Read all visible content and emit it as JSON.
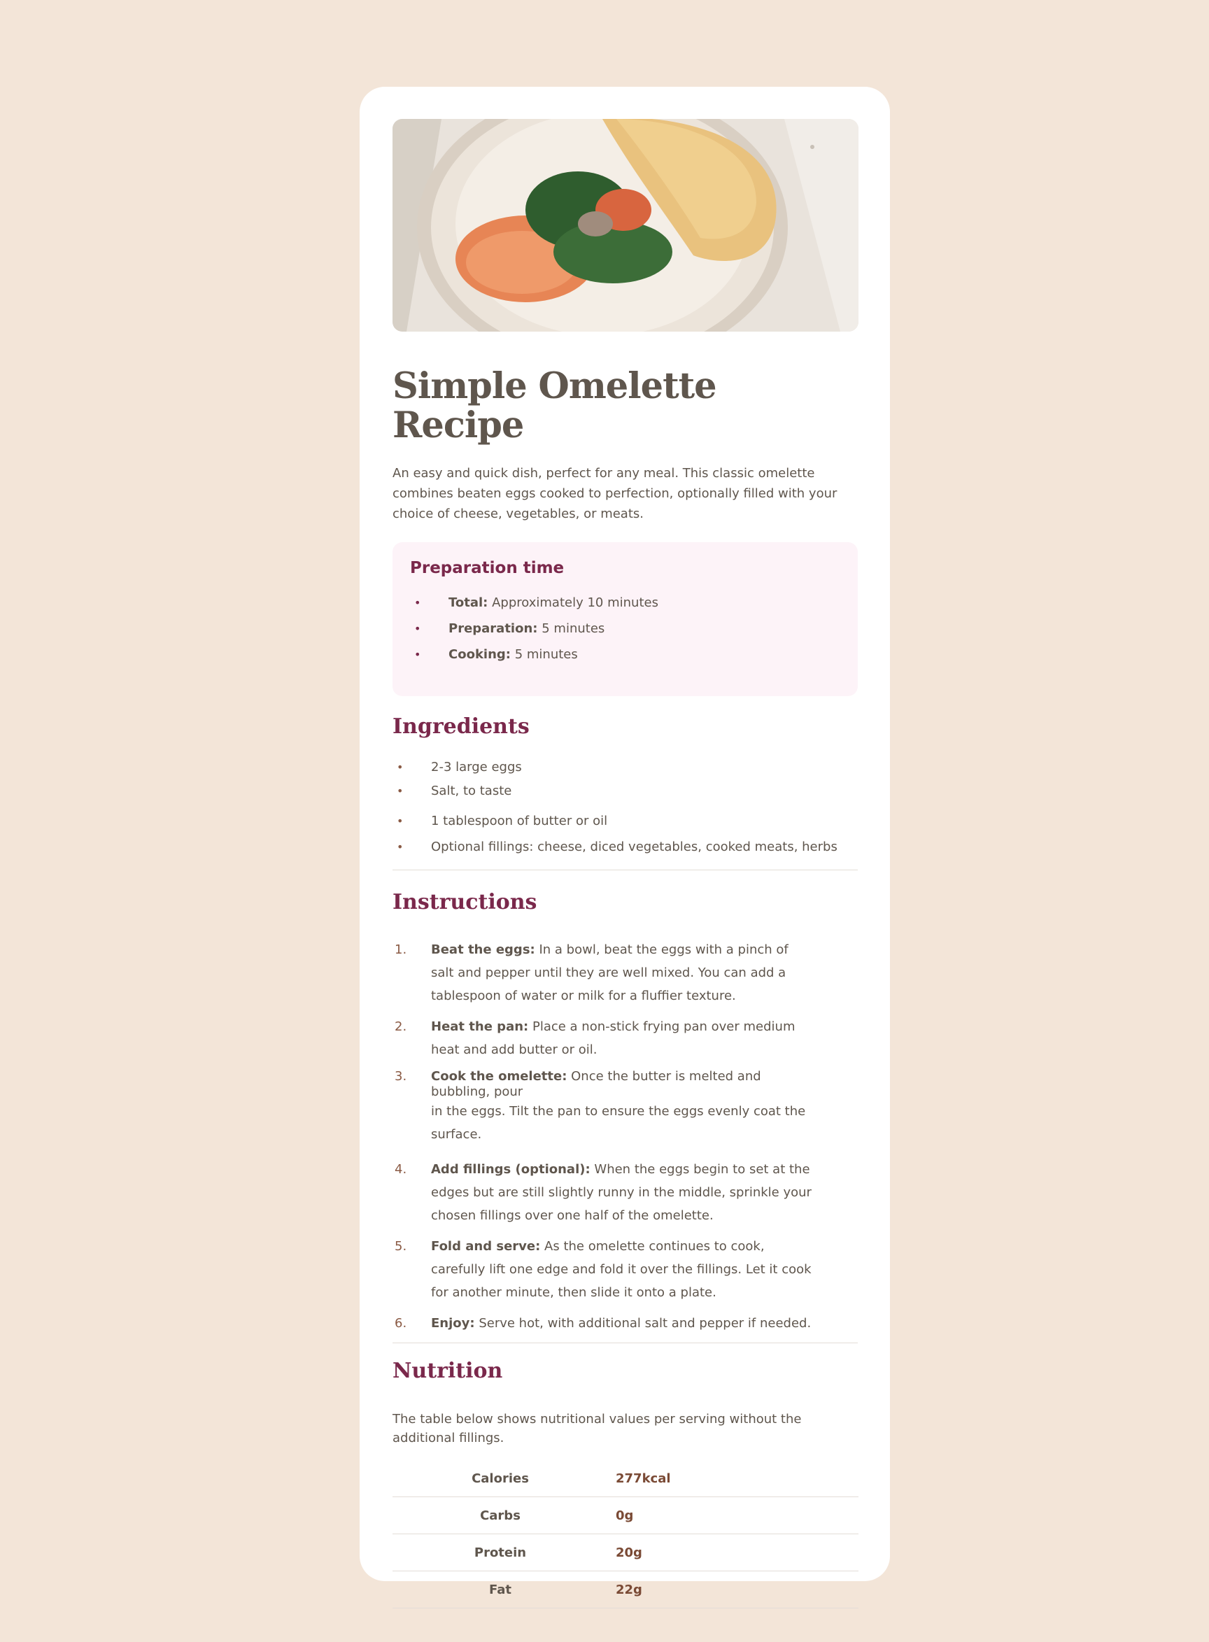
{
  "recipe": {
    "title": "Simple Omelette Recipe",
    "intro": "An easy and quick dish, perfect for any meal. This classic omelette combines beaten eggs cooked to perfection, optionally filled with your choice of cheese, vegetables, or meats."
  },
  "preparation": {
    "heading": "Preparation time",
    "items": [
      {
        "label": "Total:",
        "value": "Approximately 10 minutes"
      },
      {
        "label": "Preparation:",
        "value": "5 minutes"
      },
      {
        "label": "Cooking:",
        "value": "5 minutes"
      }
    ]
  },
  "ingredients": {
    "heading": "Ingredients",
    "items": [
      "2-3 large eggs",
      "Salt, to taste",
      "1 tablespoon of butter or oil",
      "Optional fillings: cheese, diced vegetables, cooked meats, herbs"
    ]
  },
  "instructions": {
    "heading": "Instructions",
    "steps": [
      {
        "num": "1.",
        "label": "Beat the eggs:",
        "text": "In a bowl, beat the eggs with a pinch of salt and pepper until they are well mixed. You can add a tablespoon of water or milk for a fluffier texture."
      },
      {
        "num": "2.",
        "label": "Heat the pan:",
        "text": "Place a non-stick frying pan over medium heat and add butter or oil."
      },
      {
        "num": "3.",
        "label": "Cook the omelette:",
        "text_first": "Once the butter is melted and bubbling, pour",
        "text_rest": "in the eggs. Tilt the pan to ensure the eggs evenly coat the surface."
      },
      {
        "num": "4.",
        "label": "Add fillings (optional):",
        "text": "When the eggs begin to set at the edges but are still slightly runny in the middle, sprinkle your chosen fillings over one half of the omelette."
      },
      {
        "num": "5.",
        "label": "Fold and serve:",
        "text": "As the omelette continues to cook, carefully lift one edge and fold it over the fillings. Let it cook for another minute, then slide it onto a plate."
      },
      {
        "num": "6.",
        "label": "Enjoy:",
        "text": "Serve hot, with additional salt and pepper if needed."
      }
    ]
  },
  "nutrition": {
    "heading": "Nutrition",
    "description": "The table below shows nutritional values per serving without the additional fillings.",
    "rows": [
      {
        "name": "Calories",
        "value": "277kcal"
      },
      {
        "name": "Carbs",
        "value": "0g"
      },
      {
        "name": "Protein",
        "value": "20g"
      },
      {
        "name": "Fat",
        "value": "22g"
      }
    ]
  },
  "colors": {
    "background": "#f3e5d8",
    "card": "#ffffff",
    "accent": "#7a284b",
    "text": "#5f564d",
    "prep_box": "#fdf3f8"
  }
}
